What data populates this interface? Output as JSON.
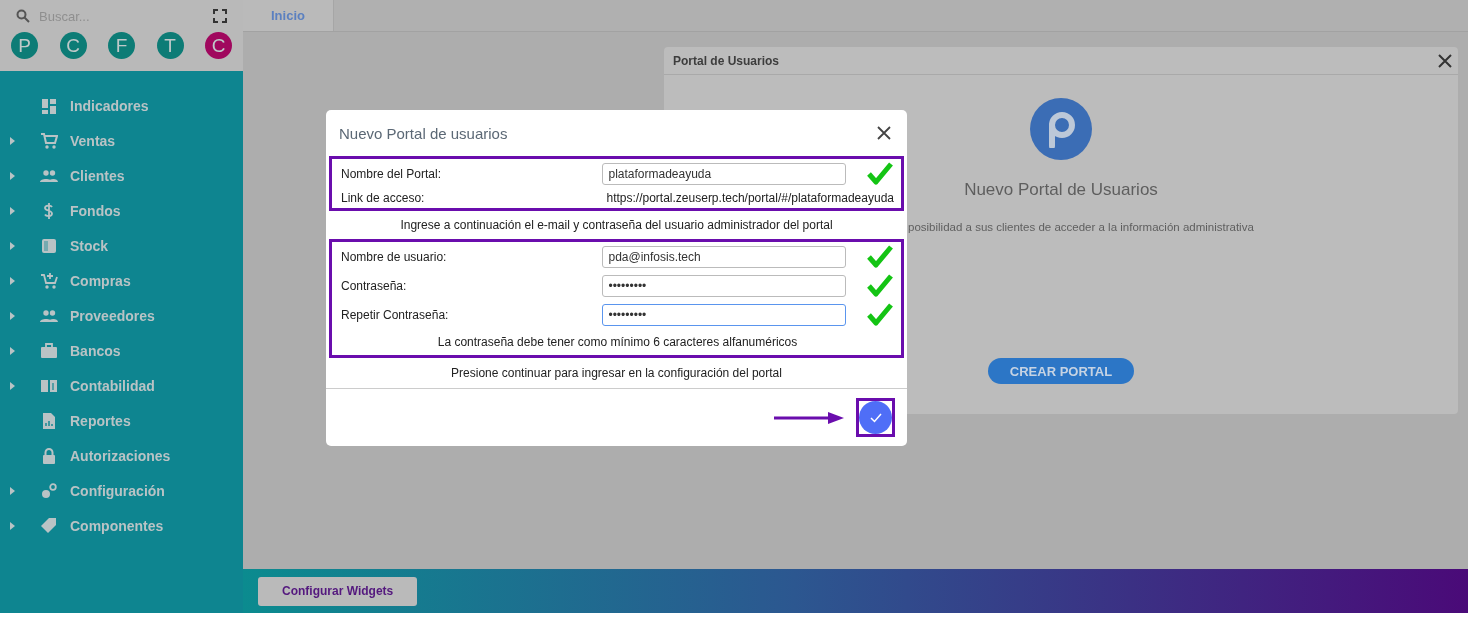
{
  "sidebar": {
    "search": {
      "placeholder": "Buscar..."
    },
    "shortcuts": [
      {
        "label": "P",
        "color": "#0d7c76"
      },
      {
        "label": "C",
        "color": "#0d7c76"
      },
      {
        "label": "F",
        "color": "#0d7c76"
      },
      {
        "label": "T",
        "color": "#0d7c76"
      },
      {
        "label": "C",
        "color": "#a0085e"
      }
    ],
    "items": [
      {
        "label": "Indicadores",
        "expandable": false
      },
      {
        "label": "Ventas",
        "expandable": true
      },
      {
        "label": "Clientes",
        "expandable": true
      },
      {
        "label": "Fondos",
        "expandable": true
      },
      {
        "label": "Stock",
        "expandable": true
      },
      {
        "label": "Compras",
        "expandable": true
      },
      {
        "label": "Proveedores",
        "expandable": true
      },
      {
        "label": "Bancos",
        "expandable": true
      },
      {
        "label": "Contabilidad",
        "expandable": true
      },
      {
        "label": "Reportes",
        "expandable": false
      },
      {
        "label": "Autorizaciones",
        "expandable": false
      },
      {
        "label": "Configuración",
        "expandable": true
      },
      {
        "label": "Componentes",
        "expandable": true
      }
    ]
  },
  "tabs": [
    {
      "label": "Inicio",
      "selected": true
    }
  ],
  "portal_card": {
    "title": "Portal de Usuarios",
    "heading": "Nuevo Portal de Usuarios",
    "description": "posibilidad a sus clientes de acceder a la información administrativa",
    "button": "CREAR PORTAL"
  },
  "dialog": {
    "title": "Nuevo Portal de usuarios",
    "portal_section": {
      "highlighted": true,
      "name_label": "Nombre del Portal:",
      "name_value": "plataformadeayuda",
      "name_valid": true,
      "link_label": "Link de acceso:",
      "link_value": "https://portal.zeuserp.tech/portal/#/plataformadeayuda"
    },
    "instruction": "Ingrese a continuación el e-mail y contraseña del usuario administrador del portal",
    "user_section": {
      "highlighted": true,
      "fields": [
        {
          "label": "Nombre de usuario:",
          "value": "pda@infosis.tech",
          "valid": true,
          "focused": false
        },
        {
          "label": "Contraseña:",
          "value": "•••••••••",
          "valid": true,
          "focused": false
        },
        {
          "label": "Repetir Contraseña:",
          "value": "•••••••••",
          "valid": true,
          "focused": true
        }
      ],
      "hint": "La contraseña debe tener como mínimo 6 caracteres alfanuméricos"
    },
    "footer_note": "Presione continuar para ingresar en la configuración del portal",
    "submit": {
      "highlighted": true
    }
  },
  "bottom_bar": {
    "button": "Configurar Widgets"
  }
}
